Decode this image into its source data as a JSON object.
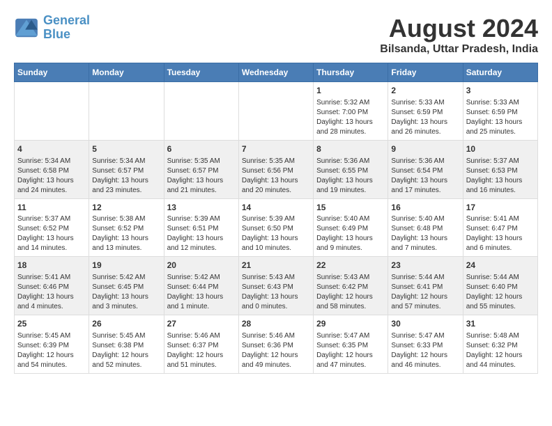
{
  "logo": {
    "line1": "General",
    "line2": "Blue"
  },
  "title": "August 2024",
  "subtitle": "Bilsanda, Uttar Pradesh, India",
  "days_of_week": [
    "Sunday",
    "Monday",
    "Tuesday",
    "Wednesday",
    "Thursday",
    "Friday",
    "Saturday"
  ],
  "weeks": [
    [
      {
        "day": "",
        "info": ""
      },
      {
        "day": "",
        "info": ""
      },
      {
        "day": "",
        "info": ""
      },
      {
        "day": "",
        "info": ""
      },
      {
        "day": "1",
        "info": "Sunrise: 5:32 AM\nSunset: 7:00 PM\nDaylight: 13 hours\nand 28 minutes."
      },
      {
        "day": "2",
        "info": "Sunrise: 5:33 AM\nSunset: 6:59 PM\nDaylight: 13 hours\nand 26 minutes."
      },
      {
        "day": "3",
        "info": "Sunrise: 5:33 AM\nSunset: 6:59 PM\nDaylight: 13 hours\nand 25 minutes."
      }
    ],
    [
      {
        "day": "4",
        "info": "Sunrise: 5:34 AM\nSunset: 6:58 PM\nDaylight: 13 hours\nand 24 minutes."
      },
      {
        "day": "5",
        "info": "Sunrise: 5:34 AM\nSunset: 6:57 PM\nDaylight: 13 hours\nand 23 minutes."
      },
      {
        "day": "6",
        "info": "Sunrise: 5:35 AM\nSunset: 6:57 PM\nDaylight: 13 hours\nand 21 minutes."
      },
      {
        "day": "7",
        "info": "Sunrise: 5:35 AM\nSunset: 6:56 PM\nDaylight: 13 hours\nand 20 minutes."
      },
      {
        "day": "8",
        "info": "Sunrise: 5:36 AM\nSunset: 6:55 PM\nDaylight: 13 hours\nand 19 minutes."
      },
      {
        "day": "9",
        "info": "Sunrise: 5:36 AM\nSunset: 6:54 PM\nDaylight: 13 hours\nand 17 minutes."
      },
      {
        "day": "10",
        "info": "Sunrise: 5:37 AM\nSunset: 6:53 PM\nDaylight: 13 hours\nand 16 minutes."
      }
    ],
    [
      {
        "day": "11",
        "info": "Sunrise: 5:37 AM\nSunset: 6:52 PM\nDaylight: 13 hours\nand 14 minutes."
      },
      {
        "day": "12",
        "info": "Sunrise: 5:38 AM\nSunset: 6:52 PM\nDaylight: 13 hours\nand 13 minutes."
      },
      {
        "day": "13",
        "info": "Sunrise: 5:39 AM\nSunset: 6:51 PM\nDaylight: 13 hours\nand 12 minutes."
      },
      {
        "day": "14",
        "info": "Sunrise: 5:39 AM\nSunset: 6:50 PM\nDaylight: 13 hours\nand 10 minutes."
      },
      {
        "day": "15",
        "info": "Sunrise: 5:40 AM\nSunset: 6:49 PM\nDaylight: 13 hours\nand 9 minutes."
      },
      {
        "day": "16",
        "info": "Sunrise: 5:40 AM\nSunset: 6:48 PM\nDaylight: 13 hours\nand 7 minutes."
      },
      {
        "day": "17",
        "info": "Sunrise: 5:41 AM\nSunset: 6:47 PM\nDaylight: 13 hours\nand 6 minutes."
      }
    ],
    [
      {
        "day": "18",
        "info": "Sunrise: 5:41 AM\nSunset: 6:46 PM\nDaylight: 13 hours\nand 4 minutes."
      },
      {
        "day": "19",
        "info": "Sunrise: 5:42 AM\nSunset: 6:45 PM\nDaylight: 13 hours\nand 3 minutes."
      },
      {
        "day": "20",
        "info": "Sunrise: 5:42 AM\nSunset: 6:44 PM\nDaylight: 13 hours\nand 1 minute."
      },
      {
        "day": "21",
        "info": "Sunrise: 5:43 AM\nSunset: 6:43 PM\nDaylight: 13 hours\nand 0 minutes."
      },
      {
        "day": "22",
        "info": "Sunrise: 5:43 AM\nSunset: 6:42 PM\nDaylight: 12 hours\nand 58 minutes."
      },
      {
        "day": "23",
        "info": "Sunrise: 5:44 AM\nSunset: 6:41 PM\nDaylight: 12 hours\nand 57 minutes."
      },
      {
        "day": "24",
        "info": "Sunrise: 5:44 AM\nSunset: 6:40 PM\nDaylight: 12 hours\nand 55 minutes."
      }
    ],
    [
      {
        "day": "25",
        "info": "Sunrise: 5:45 AM\nSunset: 6:39 PM\nDaylight: 12 hours\nand 54 minutes."
      },
      {
        "day": "26",
        "info": "Sunrise: 5:45 AM\nSunset: 6:38 PM\nDaylight: 12 hours\nand 52 minutes."
      },
      {
        "day": "27",
        "info": "Sunrise: 5:46 AM\nSunset: 6:37 PM\nDaylight: 12 hours\nand 51 minutes."
      },
      {
        "day": "28",
        "info": "Sunrise: 5:46 AM\nSunset: 6:36 PM\nDaylight: 12 hours\nand 49 minutes."
      },
      {
        "day": "29",
        "info": "Sunrise: 5:47 AM\nSunset: 6:35 PM\nDaylight: 12 hours\nand 47 minutes."
      },
      {
        "day": "30",
        "info": "Sunrise: 5:47 AM\nSunset: 6:33 PM\nDaylight: 12 hours\nand 46 minutes."
      },
      {
        "day": "31",
        "info": "Sunrise: 5:48 AM\nSunset: 6:32 PM\nDaylight: 12 hours\nand 44 minutes."
      }
    ]
  ]
}
